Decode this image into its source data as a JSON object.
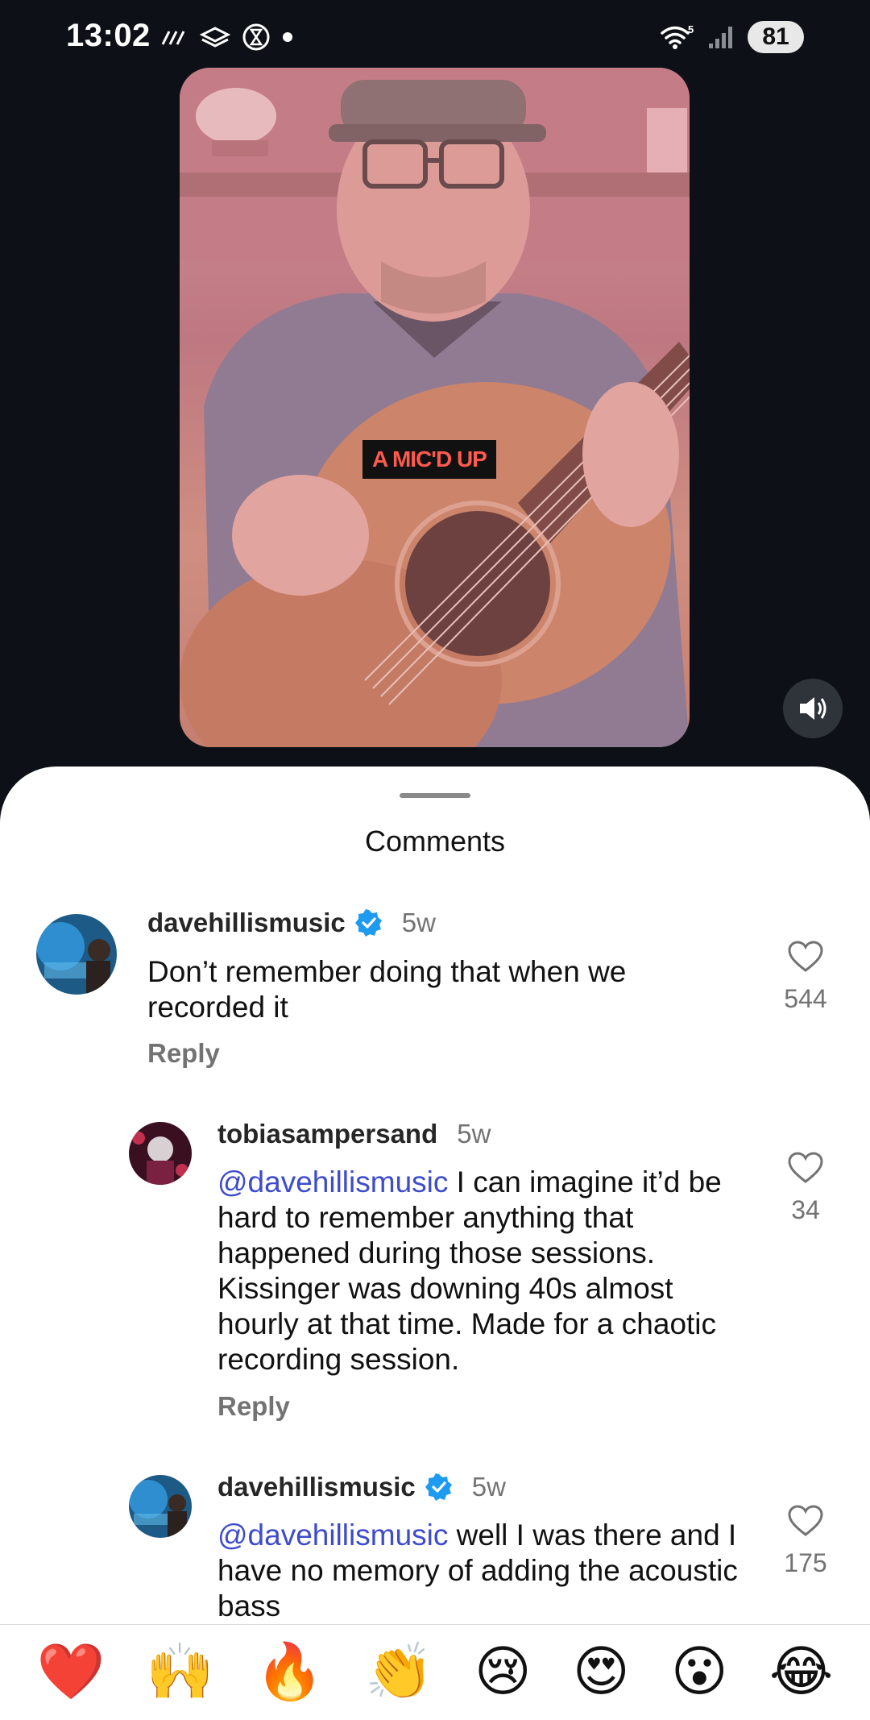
{
  "status_bar": {
    "time": "13:02",
    "battery": "81",
    "wifi_badge": "5"
  },
  "video": {
    "caption": "A MIC'D UP"
  },
  "sheet": {
    "title": "Comments"
  },
  "comments": [
    {
      "username": "davehillismusic",
      "verified": true,
      "time": "5w",
      "text": "Don’t remember doing that when we recorded it",
      "reply_label": "Reply",
      "likes": "544"
    },
    {
      "username": "tobiasampersand",
      "verified": false,
      "time": "5w",
      "mention": "@davehillismusic",
      "text": " I can imagine it’d be hard to remember anything that happened during those sessions. Kissinger was downing 40s almost hourly at that time. Made for a chaotic recording session.",
      "reply_label": "Reply",
      "likes": "34"
    },
    {
      "username": "davehillismusic",
      "verified": true,
      "time": "5w",
      "mention": "@davehillismusic",
      "text": " well I was there and I have no memory of adding the acoustic bass",
      "likes": "175"
    }
  ],
  "emoji_bar": [
    "❤️",
    "🙌",
    "🔥",
    "👏",
    "😢",
    "😍",
    "😮",
    "😂"
  ]
}
